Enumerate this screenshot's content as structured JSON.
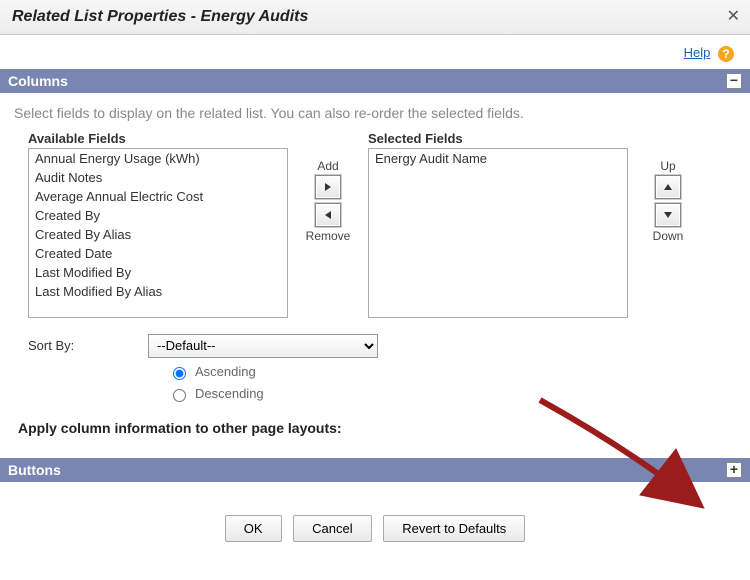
{
  "dialog": {
    "title": "Related List Properties - Energy Audits",
    "help_label": "Help"
  },
  "columns_section": {
    "header": "Columns",
    "instruction": "Select fields to display on the related list. You can also re-order the selected fields.",
    "available_label": "Available Fields",
    "selected_label": "Selected Fields",
    "add_label": "Add",
    "remove_label": "Remove",
    "up_label": "Up",
    "down_label": "Down",
    "available_fields": [
      "Annual Energy Usage (kWh)",
      "Audit Notes",
      "Average Annual Electric Cost",
      "Created By",
      "Created By Alias",
      "Created Date",
      "Last Modified By",
      "Last Modified By Alias"
    ],
    "selected_fields": [
      "Energy Audit Name"
    ],
    "sort_by_label": "Sort By:",
    "sort_default": "--Default--",
    "ascending_label": "Ascending",
    "descending_label": "Descending",
    "sort_direction": "Ascending",
    "apply_heading": "Apply column information to other page layouts:"
  },
  "buttons_section": {
    "header": "Buttons"
  },
  "footer": {
    "ok": "OK",
    "cancel": "Cancel",
    "revert": "Revert to Defaults"
  }
}
